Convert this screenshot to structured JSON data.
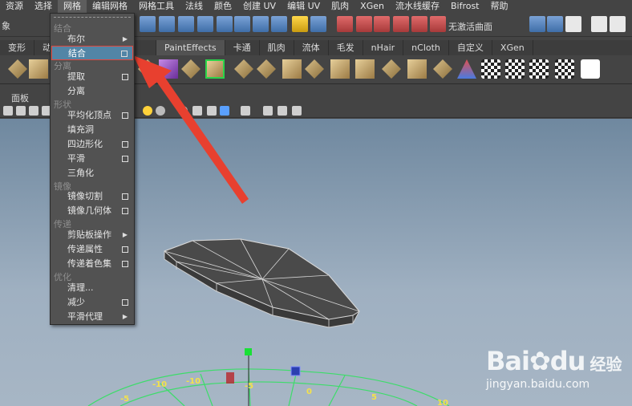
{
  "menubar": {
    "items": [
      "资源",
      "选择",
      "网格",
      "编辑网格",
      "网格工具",
      "法线",
      "颜色",
      "创建 UV",
      "编辑 UV",
      "肌肉",
      "XGen",
      "流水线缓存",
      "Bifrost",
      "帮助"
    ],
    "active_index": 2
  },
  "statusline": {
    "left_label": "象",
    "wireless_label": "无激活曲面"
  },
  "shelf_tabs": {
    "items": [
      "变形",
      "动",
      "PaintEffects",
      "卡通",
      "肌肉",
      "流体",
      "毛发",
      "nHair",
      "nCloth",
      "自定义",
      "XGen"
    ]
  },
  "panel": {
    "label": "面板"
  },
  "mesh_menu": {
    "sections": {
      "combine": "结合",
      "separate": "分离",
      "shape": "形状",
      "mirror": "镜像",
      "transfer": "传递",
      "optimize": "优化"
    },
    "items": {
      "boolean": "布尔",
      "combine": "结合",
      "extract": "提取",
      "separate": "分离",
      "average_vertices": "平均化顶点",
      "fill_hole": "填充洞",
      "quadrangulate": "四边形化",
      "smooth": "平滑",
      "triangulate": "三角化",
      "mirror_cut": "镜像切割",
      "mirror_geometry": "镜像几何体",
      "clipboard_actions": "剪贴板操作",
      "transfer_attributes": "传递属性",
      "transfer_shading_sets": "传递着色集",
      "cleanup": "清理...",
      "reduce": "减少",
      "smooth_proxy": "平滑代理"
    }
  },
  "viewport": {
    "grid_labels": [
      "-10",
      "-10",
      "-5",
      "-5",
      "0",
      "5",
      "10"
    ]
  },
  "watermark": {
    "brand": "Bai",
    "brand_tail": "du",
    "cn": "经验",
    "url": "jingyan.baidu.com"
  },
  "colors": {
    "highlight": "#5285a6",
    "highlight_border": "#e0463c",
    "arrow": "#e8402f",
    "wireframe_green": "#3ddc6a"
  }
}
